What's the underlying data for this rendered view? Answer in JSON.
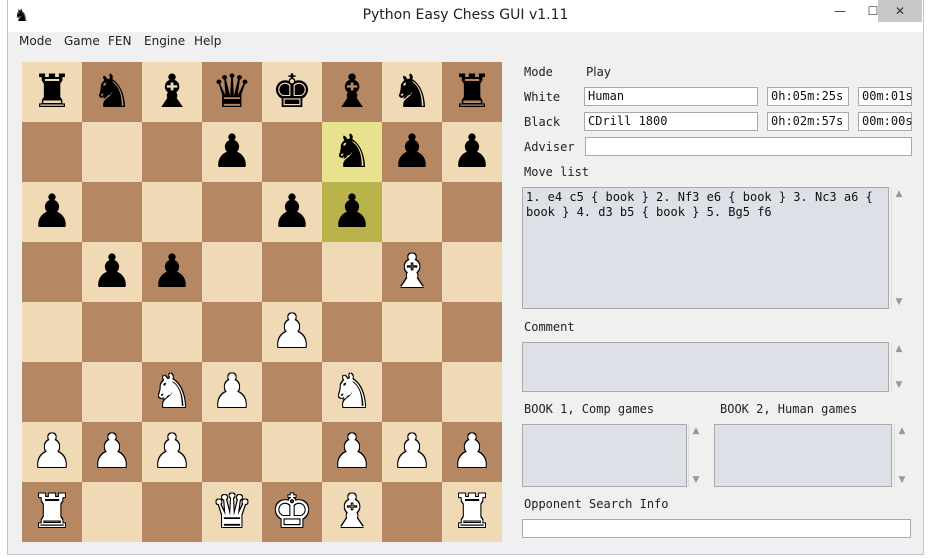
{
  "window": {
    "title": "Python Easy Chess GUI v1.11",
    "app_icon": "♞",
    "minimize": "—",
    "maximize": "☐",
    "close": "✕"
  },
  "menu": [
    "Mode",
    "Game",
    "FEN",
    "Engine",
    "Help"
  ],
  "board": {
    "light_color": "#f0d9b5",
    "dark_color": "#b58863",
    "highlight_from": "f7",
    "highlight_to": "f6",
    "ranks": [
      "rnbqkbnr",
      "...p.npp",
      "p...pp..",
      ".pp...B.",
      "....P...",
      "..NP.N..",
      "PPP..PPP",
      "R..QKB.R"
    ]
  },
  "info": {
    "mode_label": "Mode",
    "mode_value": "Play",
    "white_label": "White",
    "white_player": "Human",
    "white_time": "0h:05m:25s",
    "white_move_time": "00m:01s",
    "black_label": "Black",
    "black_player": "CDrill 1800",
    "black_time": "0h:02m:57s",
    "black_move_time": "00m:00s",
    "adviser_label": "Adviser",
    "adviser_value": "",
    "move_list_label": "Move list",
    "move_list": "1. e4 c5 { book } 2. Nf3 e6 { book } 3. Nc3 a6 { book } 4. d3 b5 { book } 5. Bg5 f6",
    "comment_label": "Comment",
    "comment": "",
    "book1_label": "BOOK 1, Comp games",
    "book1": "",
    "book2_label": "BOOK 2, Human games",
    "book2": "",
    "opponent_label": "Opponent Search Info",
    "opponent_info": ""
  }
}
